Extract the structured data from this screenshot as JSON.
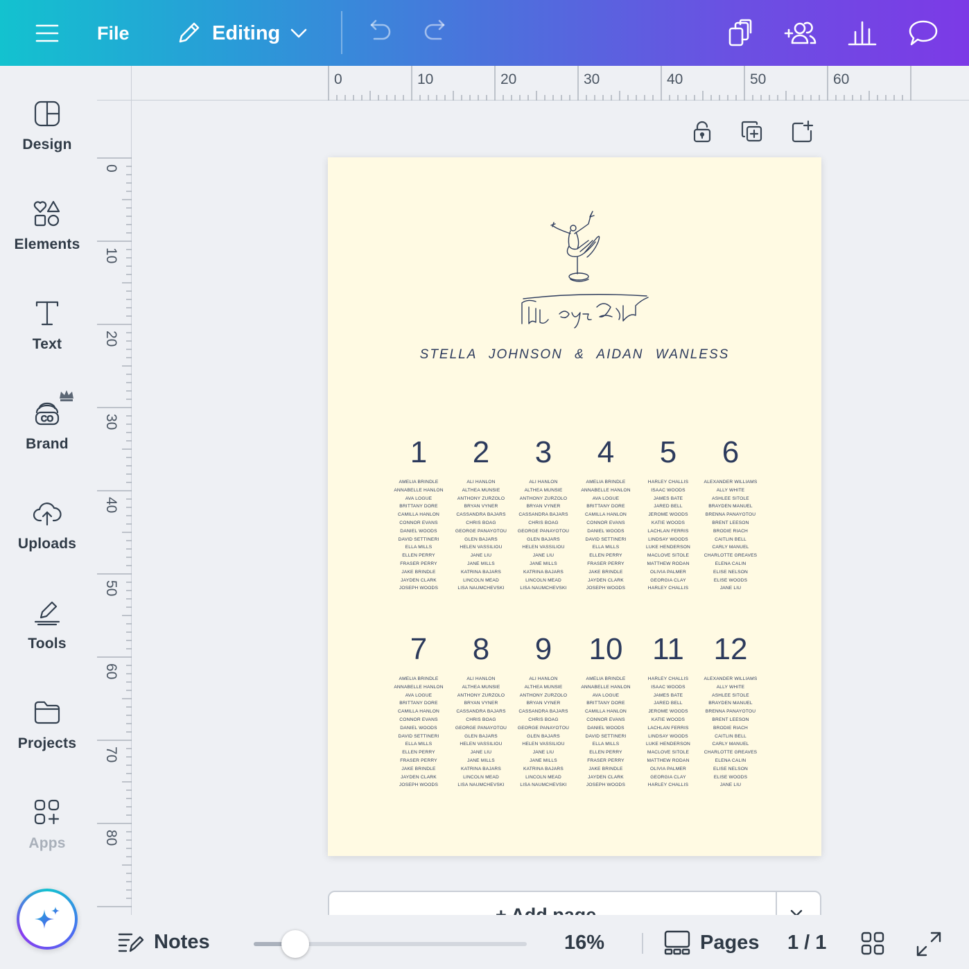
{
  "topbar": {
    "menu_icon": "hamburger-icon",
    "file_label": "File",
    "editing_label": "Editing",
    "undo_icon": "undo-icon",
    "redo_icon": "redo-icon",
    "right_icons": [
      "resize-icon",
      "share-people-icon",
      "insights-chart-icon",
      "comment-icon"
    ]
  },
  "sidebar": {
    "items": [
      {
        "label": "Design",
        "icon": "design-layout-icon"
      },
      {
        "label": "Elements",
        "icon": "elements-shapes-icon"
      },
      {
        "label": "Text",
        "icon": "text-t-icon"
      },
      {
        "label": "Brand",
        "icon": "brand-kit-icon"
      },
      {
        "label": "Uploads",
        "icon": "upload-cloud-icon"
      },
      {
        "label": "Tools",
        "icon": "tools-pen-icon"
      },
      {
        "label": "Projects",
        "icon": "folder-icon"
      },
      {
        "label": "Apps",
        "icon": "apps-grid-icon"
      }
    ],
    "magic_icon": "magic-sparkle-icon"
  },
  "ruler": {
    "horizontal": [
      "0",
      "10",
      "20",
      "30",
      "40",
      "50",
      "60"
    ],
    "vertical": [
      "0",
      "10",
      "20",
      "30",
      "40",
      "50",
      "60",
      "70",
      "80"
    ]
  },
  "page_tools": [
    "lock-icon",
    "duplicate-page-icon",
    "add-page-icon"
  ],
  "design": {
    "couple": "STELLA JOHNSON  &  AIDAN WANLESS",
    "tables": [
      {
        "number": "1",
        "guests": [
          "AMELIA BRINDLE",
          "ANNABELLE HANLON",
          "AVA LOGUE",
          "BRITTANY DORE",
          "CAMILLA HANLON",
          "CONNOR EVANS",
          "DANIEL WOODS",
          "DAVID SETTINERI",
          "ELLA MILLS",
          "ELLEN PERRY",
          "FRASER PERRY",
          "JAKE BRINDLE",
          "JAYDEN CLARK",
          "JOSEPH WOODS"
        ]
      },
      {
        "number": "2",
        "guests": [
          "ALI HANLON",
          "ALTHEA MUNSIE",
          "ANTHONY ZURZOLO",
          "BRYAN VYNER",
          "CASSANDRA BAJARS",
          "CHRIS BOAG",
          "GEORGE PANAYOTOU",
          "GLEN BAJARS",
          "HELEN VASSILIOU",
          "JANE LIU",
          "JANE MILLS",
          "KATRINA BAJARS",
          "LINCOLN MEAD",
          "LISA NAUMCHEVSKI"
        ]
      },
      {
        "number": "3",
        "guests": [
          "ALI HANLON",
          "ALTHEA MUNSIE",
          "ANTHONY ZURZOLO",
          "BRYAN VYNER",
          "CASSANDRA BAJARS",
          "CHRIS BOAG",
          "GEORGE PANAYOTOU",
          "GLEN BAJARS",
          "HELEN VASSILIOU",
          "JANE LIU",
          "JANE MILLS",
          "KATRINA BAJARS",
          "LINCOLN MEAD",
          "LISA NAUMCHEVSKI"
        ]
      },
      {
        "number": "4",
        "guests": [
          "AMELIA BRINDLE",
          "ANNABELLE HANLON",
          "AVA LOGUE",
          "BRITTANY DORE",
          "CAMILLA HANLON",
          "CONNOR EVANS",
          "DANIEL WOODS",
          "DAVID SETTINERI",
          "ELLA MILLS",
          "ELLEN PERRY",
          "FRASER PERRY",
          "JAKE BRINDLE",
          "JAYDEN CLARK",
          "JOSEPH WOODS"
        ]
      },
      {
        "number": "5",
        "guests": [
          "HARLEY CHALLIS",
          "ISAAC WOODS",
          "JAMES BATE",
          "JARED BELL",
          "JEROME WOODS",
          "KATIE WOODS",
          "LACHLAN FERRIS",
          "LINDSAY WOODS",
          "LUKE HENDERSON",
          "MACLOVE SITOLE",
          "MATTHEW RODAN",
          "OLIVIA PALMER",
          "GEORGIA CLAY",
          "HARLEY CHALLIS"
        ]
      },
      {
        "number": "6",
        "guests": [
          "ALEXANDER WILLIAMS",
          "ALLY WHITE",
          "ASHLEE SITOLE",
          "BRAYDEN MANUEL",
          "BRENNA PANAYOTOU",
          "BRENT LEESON",
          "BRODIE RIACH",
          "CAITLIN BELL",
          "CARLY MANUEL",
          "CHARLOTTE GREAVES",
          "ELENA CALIN",
          "ELISE NELSON",
          "ELISE WOODS",
          "JANE LIU"
        ]
      },
      {
        "number": "7",
        "guests": [
          "AMELIA BRINDLE",
          "ANNABELLE HANLON",
          "AVA LOGUE",
          "BRITTANY DORE",
          "CAMILLA HANLON",
          "CONNOR EVANS",
          "DANIEL WOODS",
          "DAVID SETTINERI",
          "ELLA MILLS",
          "ELLEN PERRY",
          "FRASER PERRY",
          "JAKE BRINDLE",
          "JAYDEN CLARK",
          "JOSEPH WOODS"
        ]
      },
      {
        "number": "8",
        "guests": [
          "ALI HANLON",
          "ALTHEA MUNSIE",
          "ANTHONY ZURZOLO",
          "BRYAN VYNER",
          "CASSANDRA BAJARS",
          "CHRIS BOAG",
          "GEORGE PANAYOTOU",
          "GLEN BAJARS",
          "HELEN VASSILIOU",
          "JANE LIU",
          "JANE MILLS",
          "KATRINA BAJARS",
          "LINCOLN MEAD",
          "LISA NAUMCHEVSKI"
        ]
      },
      {
        "number": "9",
        "guests": [
          "ALI HANLON",
          "ALTHEA MUNSIE",
          "ANTHONY ZURZOLO",
          "BRYAN VYNER",
          "CASSANDRA BAJARS",
          "CHRIS BOAG",
          "GEORGE PANAYOTOU",
          "GLEN BAJARS",
          "HELEN VASSILIOU",
          "JANE LIU",
          "JANE MILLS",
          "KATRINA BAJARS",
          "LINCOLN MEAD",
          "LISA NAUMCHEVSKI"
        ]
      },
      {
        "number": "10",
        "guests": [
          "AMELIA BRINDLE",
          "ANNABELLE HANLON",
          "AVA LOGUE",
          "BRITTANY DORE",
          "CAMILLA HANLON",
          "CONNOR EVANS",
          "DANIEL WOODS",
          "DAVID SETTINERI",
          "ELLA MILLS",
          "ELLEN PERRY",
          "FRASER PERRY",
          "JAKE BRINDLE",
          "JAYDEN CLARK",
          "JOSEPH WOODS"
        ]
      },
      {
        "number": "11",
        "guests": [
          "HARLEY CHALLIS",
          "ISAAC WOODS",
          "JAMES BATE",
          "JARED BELL",
          "JEROME WOODS",
          "KATIE WOODS",
          "LACHLAN FERRIS",
          "LINDSAY WOODS",
          "LUKE HENDERSON",
          "MACLOVE SITOLE",
          "MATTHEW RODAN",
          "OLIVIA PALMER",
          "GEORGIA CLAY",
          "HARLEY CHALLIS"
        ]
      },
      {
        "number": "12",
        "guests": [
          "ALEXANDER WILLIAMS",
          "ALLY WHITE",
          "ASHLEE SITOLE",
          "BRAYDEN MANUEL",
          "BRENNA PANAYOTOU",
          "BRENT LEESON",
          "BRODIE RIACH",
          "CAITLIN BELL",
          "CARLY MANUEL",
          "CHARLOTTE GREAVES",
          "ELENA CALIN",
          "ELISE NELSON",
          "ELISE WOODS",
          "JANE LIU"
        ]
      }
    ],
    "colors": {
      "paper": "#fffae3",
      "ink": "#2c3a5c"
    }
  },
  "add_page": {
    "label": "+ Add page"
  },
  "bottombar": {
    "notes_label": "Notes",
    "zoom_fraction": 0.16,
    "zoom_label": "16%",
    "pages_label": "Pages",
    "page_counter": "1 / 1",
    "grid_icon": "grid-view-icon",
    "fullscreen_icon": "fullscreen-icon"
  }
}
